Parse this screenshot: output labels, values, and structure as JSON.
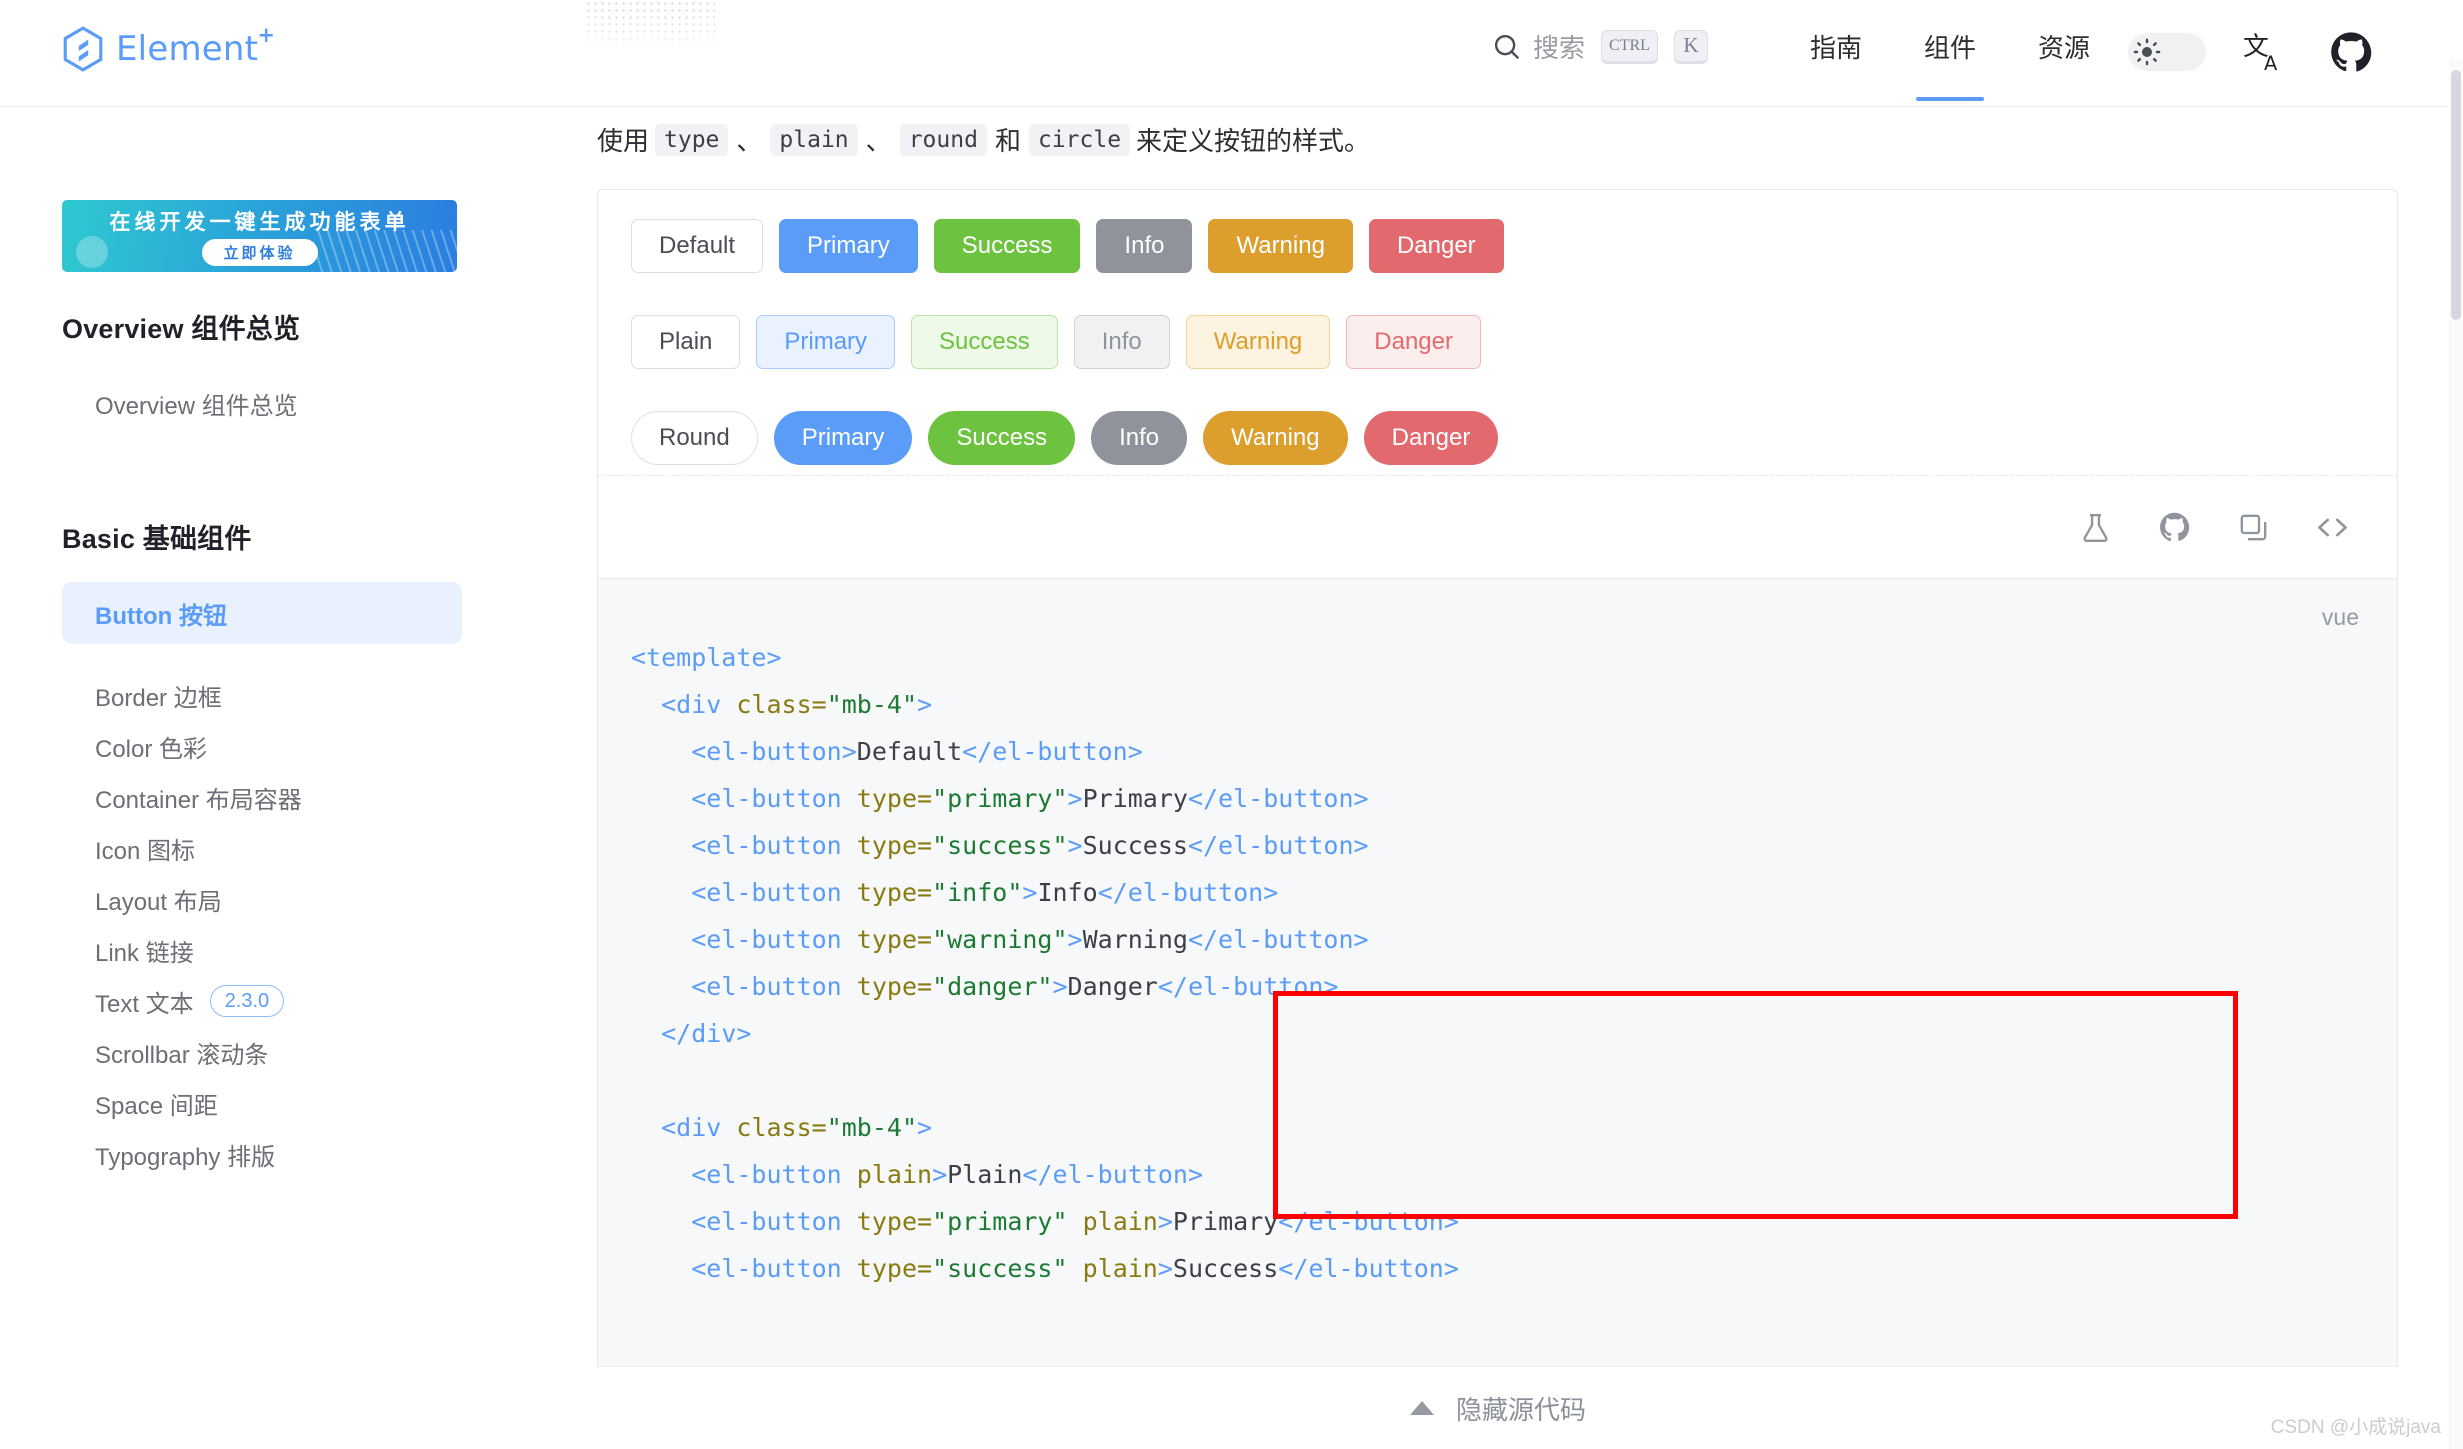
{
  "header": {
    "brand": "Element",
    "brand_superscript": "+",
    "search": {
      "label": "搜索",
      "kbd_ctrl": "CTRL",
      "kbd_key": "K"
    },
    "nav": [
      {
        "label": "指南",
        "active": false
      },
      {
        "label": "组件",
        "active": true
      },
      {
        "label": "资源",
        "active": false
      }
    ],
    "icons": {
      "search": "search-icon",
      "theme_toggle": "sun-icon",
      "language": "translate-icon",
      "github": "github-icon"
    }
  },
  "sidebar": {
    "promo": {
      "title": "在线开发一键生成功能表单",
      "cta": "立即体验"
    },
    "groups": [
      {
        "title": "Overview 组件总览",
        "items": [
          {
            "label": "Overview 组件总览",
            "active": false,
            "badge": ""
          }
        ]
      },
      {
        "title": "Basic 基础组件",
        "items": [
          {
            "label": "Button 按钮",
            "active": true,
            "badge": ""
          },
          {
            "label": "Border 边框",
            "active": false,
            "badge": ""
          },
          {
            "label": "Color 色彩",
            "active": false,
            "badge": ""
          },
          {
            "label": "Container 布局容器",
            "active": false,
            "badge": ""
          },
          {
            "label": "Icon 图标",
            "active": false,
            "badge": ""
          },
          {
            "label": "Layout 布局",
            "active": false,
            "badge": ""
          },
          {
            "label": "Link 链接",
            "active": false,
            "badge": ""
          },
          {
            "label": "Text 文本",
            "active": false,
            "badge": "2.3.0"
          },
          {
            "label": "Scrollbar 滚动条",
            "active": false,
            "badge": ""
          },
          {
            "label": "Space 间距",
            "active": false,
            "badge": ""
          },
          {
            "label": "Typography 排版",
            "active": false,
            "badge": ""
          }
        ]
      }
    ]
  },
  "main": {
    "description": {
      "prefix": "使用",
      "codes": [
        "type",
        "plain",
        "round",
        "circle"
      ],
      "sep": "、",
      "conj": "和",
      "suffix": "来定义按钮的样式。"
    },
    "demo": {
      "row_basic": [
        {
          "label": "Default",
          "variant": "default"
        },
        {
          "label": "Primary",
          "variant": "primary"
        },
        {
          "label": "Success",
          "variant": "success"
        },
        {
          "label": "Info",
          "variant": "info"
        },
        {
          "label": "Warning",
          "variant": "warning"
        },
        {
          "label": "Danger",
          "variant": "danger"
        }
      ],
      "row_plain": [
        {
          "label": "Plain",
          "variant": "default"
        },
        {
          "label": "Primary",
          "variant": "primary"
        },
        {
          "label": "Success",
          "variant": "success"
        },
        {
          "label": "Info",
          "variant": "info"
        },
        {
          "label": "Warning",
          "variant": "warning"
        },
        {
          "label": "Danger",
          "variant": "danger"
        }
      ],
      "row_round": [
        {
          "label": "Round",
          "variant": "default"
        },
        {
          "label": "Primary",
          "variant": "primary"
        },
        {
          "label": "Success",
          "variant": "success"
        },
        {
          "label": "Info",
          "variant": "info"
        },
        {
          "label": "Warning",
          "variant": "warning"
        },
        {
          "label": "Danger",
          "variant": "danger"
        }
      ],
      "row_circle": [
        {
          "icon": "search-icon",
          "variant": "default"
        },
        {
          "icon": "edit-icon",
          "variant": "primary"
        },
        {
          "icon": "check-icon",
          "variant": "success"
        },
        {
          "icon": "message-icon",
          "variant": "info"
        },
        {
          "icon": "star-icon",
          "variant": "warning"
        },
        {
          "icon": "delete-icon",
          "variant": "danger"
        }
      ]
    },
    "toolbar_icons": [
      "flask-icon",
      "github-icon",
      "copy-icon",
      "code-icon"
    ],
    "code_lang": "vue",
    "hide_source_label": "隐藏源代码"
  },
  "colors": {
    "primary": "#5a9cf8",
    "success": "#6dc23f",
    "info": "#8f939b",
    "warning": "#dc9e2d",
    "danger": "#e26a6f",
    "highlight_box": "#ff0000",
    "active_bg": "#e9f1fe"
  },
  "watermark": "CSDN @小成说java"
}
